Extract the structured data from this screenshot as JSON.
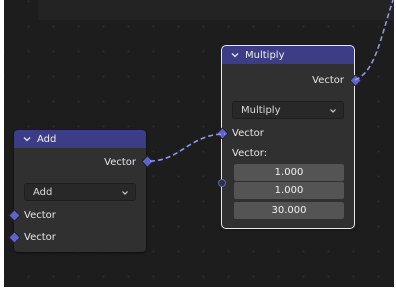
{
  "nodes": {
    "add": {
      "title": "Add",
      "output_label": "Vector",
      "operation": "Add",
      "inputs": [
        "Vector",
        "Vector"
      ]
    },
    "multiply": {
      "title": "Multiply",
      "output_label": "Vector",
      "operation": "Multiply",
      "input_label": "Vector",
      "vector_label": "Vector:",
      "values": [
        "1.000",
        "1.000",
        "30.000"
      ]
    }
  },
  "colors": {
    "canvas": "#1d1d1d",
    "node_body": "#303030",
    "node_header": "#3d3d87",
    "socket": "#6363c7",
    "wire": "#a0a0ff"
  },
  "icons": {
    "collapse": "chevron-down-icon",
    "dropdown": "chevron-down-icon",
    "socket": "diamond-socket-icon"
  }
}
